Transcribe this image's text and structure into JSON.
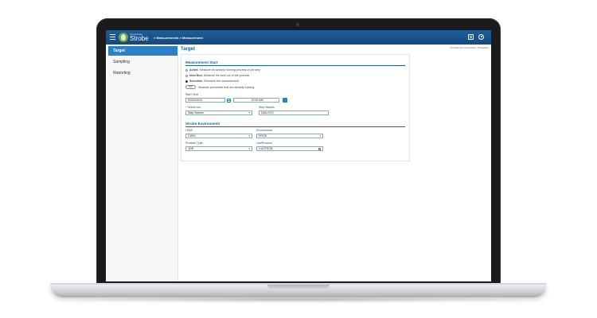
{
  "header": {
    "brand_small": "Compuware",
    "brand": "Strobe",
    "breadcrumb": "> Measurements > Measurement"
  },
  "connection": "Current host connection: Production",
  "sidebar": {
    "items": [
      {
        "label": "Target",
        "active": true
      },
      {
        "label": "Sampling",
        "active": false
      },
      {
        "label": "Reporting",
        "active": false
      }
    ]
  },
  "page_title": "Target",
  "measurement_start": {
    "title": "Measurement Start",
    "options": [
      {
        "bold": "Active.",
        "text": " Measure an actively running process or job step",
        "selected": false
      },
      {
        "bold": "Next Run.",
        "text": " Measure the next run of the process",
        "selected": false
      },
      {
        "bold": "Schedule.",
        "text": " Schedule the measurement",
        "selected": true
      }
    ],
    "toggle_label": "OFF",
    "toggle_text": "Measure processes that are already running",
    "start_time_label": "Start Time",
    "start_date": "02/02/2019",
    "start_clock": "12:00 AM",
    "select_one_label": "* Select one",
    "select_one_value": "Step Names",
    "step_names_label": "Step Names",
    "step_names_value": "DAILYGO"
  },
  "strobe_environment": {
    "title": "Strobe Environment",
    "lpar_label": "LPAR",
    "lpar_value": "CW01",
    "environment_label": "Environment",
    "environment_value": "PROD",
    "process_type_label": "Process Type",
    "process_type_value": "JOB",
    "job_label": "Job/Process",
    "job_value": "CUSTDCB"
  },
  "colors": {
    "accent": "#1e5d99",
    "active_nav": "#2d80c8",
    "logo_green": "#6aa843"
  }
}
